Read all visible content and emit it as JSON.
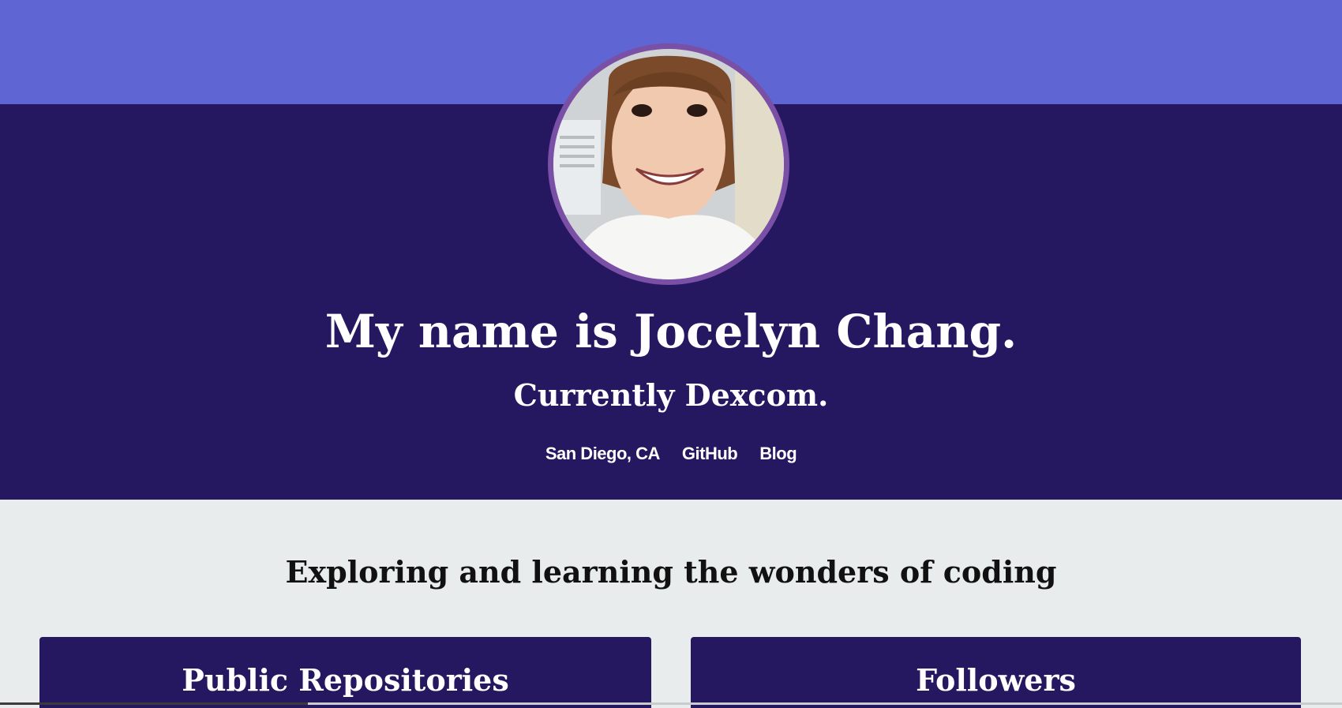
{
  "colors": {
    "top_band": "#5f66d4",
    "hero_bg": "#251760",
    "page_bg": "#e8ecec",
    "avatar_ring": "#7a4fa6",
    "card_bg": "#251760"
  },
  "hero": {
    "title": "My name is Jocelyn Chang.",
    "subtitle": "Currently Dexcom.",
    "links": [
      {
        "label": "San Diego, CA"
      },
      {
        "label": "GitHub"
      },
      {
        "label": "Blog"
      }
    ]
  },
  "main": {
    "tagline": "Exploring and learning the wonders of coding",
    "cards": [
      {
        "title": "Public Repositories"
      },
      {
        "title": "Followers"
      }
    ]
  }
}
